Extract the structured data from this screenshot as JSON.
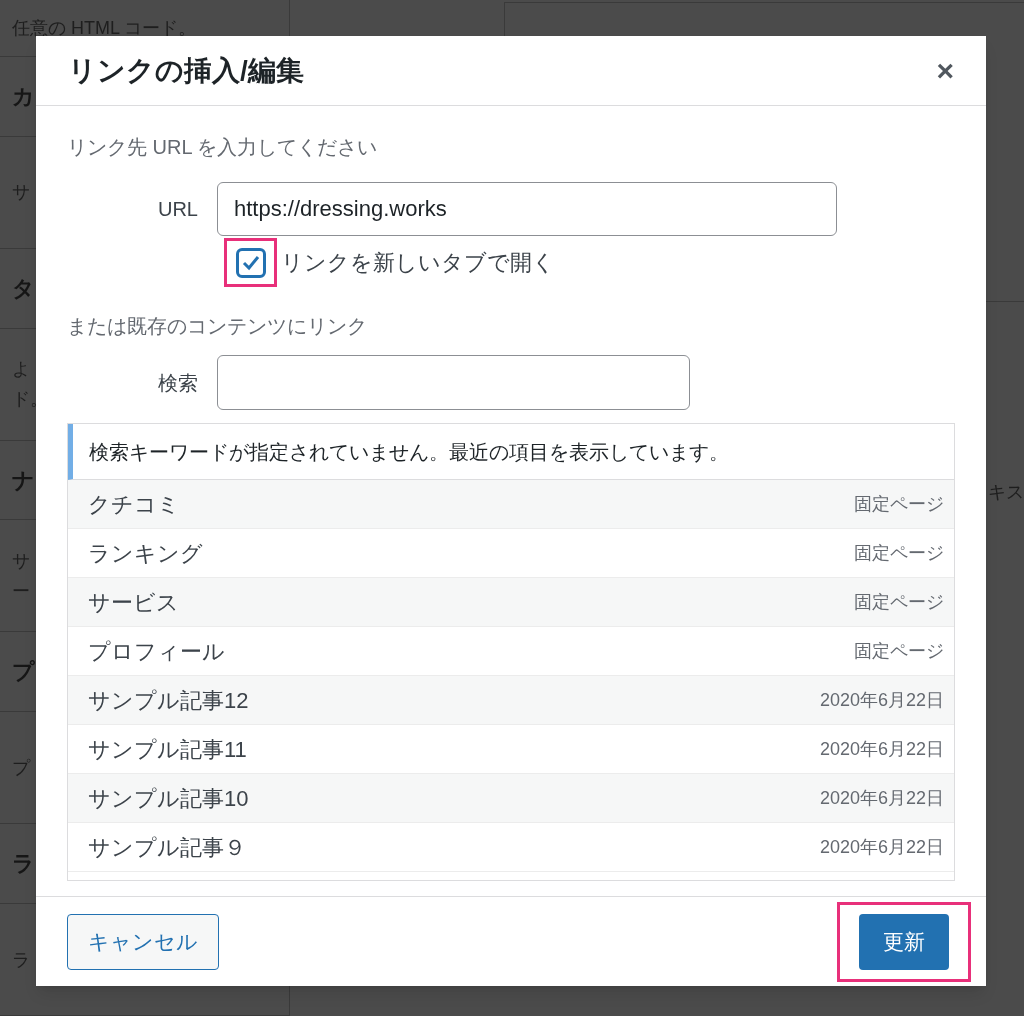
{
  "background": {
    "left_rows": [
      {
        "kind": "desc",
        "text": "任意の HTML コード。"
      },
      {
        "kind": "heading",
        "text": "カ"
      },
      {
        "kind": "desc",
        "text": "サ"
      },
      {
        "kind": "heading",
        "text": "タ"
      },
      {
        "kind": "desc",
        "lines": [
          "よ",
          "ド。"
        ]
      },
      {
        "kind": "heading",
        "text": "ナ"
      },
      {
        "kind": "desc",
        "lines": [
          "サ",
          "ー"
        ]
      },
      {
        "kind": "heading",
        "text": "プ"
      },
      {
        "kind": "desc",
        "text": "プ"
      },
      {
        "kind": "heading",
        "text": "ラ"
      },
      {
        "kind": "desc",
        "text": "ラ"
      }
    ],
    "right_fragment": "キス"
  },
  "dialog": {
    "title": "リンクの挿入/編集",
    "close": "×",
    "url_section": {
      "heading": "リンク先 URL を入力してください",
      "label": "URL",
      "value": "https://dressing.works"
    },
    "new_tab": {
      "label": "リンクを新しいタブで開く",
      "checked": true,
      "highlighted": true
    },
    "existing_section": {
      "heading": "または既存のコンテンツにリンク",
      "search_label": "検索"
    },
    "notice": "検索キーワードが指定されていません。最近の項目を表示しています。",
    "results": [
      {
        "title": "クチコミ",
        "meta": "固定ページ"
      },
      {
        "title": "ランキング",
        "meta": "固定ページ"
      },
      {
        "title": "サービス",
        "meta": "固定ページ"
      },
      {
        "title": "プロフィール",
        "meta": "固定ページ"
      },
      {
        "title": "サンプル記事12",
        "meta": "2020年6月22日"
      },
      {
        "title": "サンプル記事11",
        "meta": "2020年6月22日"
      },
      {
        "title": "サンプル記事10",
        "meta": "2020年6月22日"
      },
      {
        "title": "サンプル記事９",
        "meta": "2020年6月22日"
      }
    ],
    "cancel_button": "キャンセル",
    "update_button": {
      "label": "更新",
      "highlighted": true
    }
  }
}
